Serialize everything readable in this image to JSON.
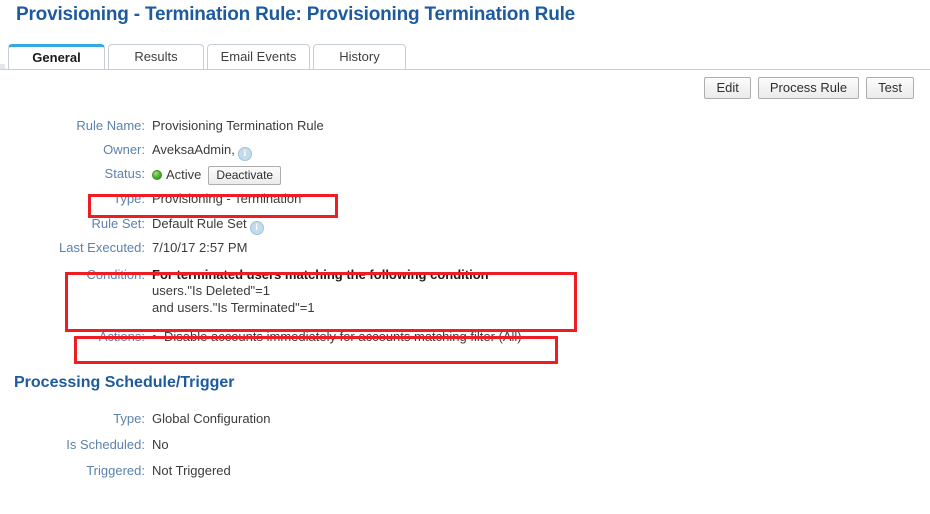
{
  "header": {
    "title": "Provisioning - Termination Rule: Provisioning Termination Rule"
  },
  "tabs": [
    {
      "label": "General",
      "active": true
    },
    {
      "label": "Results",
      "active": false
    },
    {
      "label": "Email Events",
      "active": false
    },
    {
      "label": "History",
      "active": false
    }
  ],
  "toolbar": {
    "edit_label": "Edit",
    "process_rule_label": "Process Rule",
    "test_label": "Test"
  },
  "general": {
    "rule_name_label": "Rule Name:",
    "rule_name_value": "Provisioning Termination Rule",
    "owner_label": "Owner:",
    "owner_value": "AveksaAdmin,",
    "owner_info_icon": "info-icon",
    "status_label": "Status:",
    "status_value": "Active",
    "status_dot_icon": "green-status-dot-icon",
    "deactivate_label": "Deactivate",
    "type_label": "Type:",
    "type_value": "Provisioning - Termination",
    "rule_set_label": "Rule Set:",
    "rule_set_value": "Default Rule Set",
    "rule_set_info_icon": "info-icon",
    "last_executed_label": "Last Executed:",
    "last_executed_value": "7/10/17 2:57 PM",
    "condition_label": "Condition:",
    "condition_heading": "For terminated users matching the following condition",
    "condition_lines": [
      "users.\"Is Deleted\"=1",
      "and users.\"Is Terminated\"=1"
    ],
    "actions_label": "Actions:",
    "actions_bullet": "•",
    "actions_value": "Disable accounts immediately for accounts matching filter (All)"
  },
  "schedule": {
    "section_title": "Processing Schedule/Trigger",
    "type_label": "Type:",
    "type_value": "Global Configuration",
    "is_scheduled_label": "Is Scheduled:",
    "is_scheduled_value": "No",
    "triggered_label": "Triggered:",
    "triggered_value": "Not Triggered"
  },
  "annotations": {
    "highlight_color": "#ee1d24",
    "boxes": [
      "type-row",
      "condition-row",
      "actions-row"
    ]
  },
  "colors": {
    "title_blue": "#1d5b9e",
    "label_blue": "#5c82ad",
    "active_tab_top": "#35a9e0",
    "status_green": "#49b02c"
  }
}
